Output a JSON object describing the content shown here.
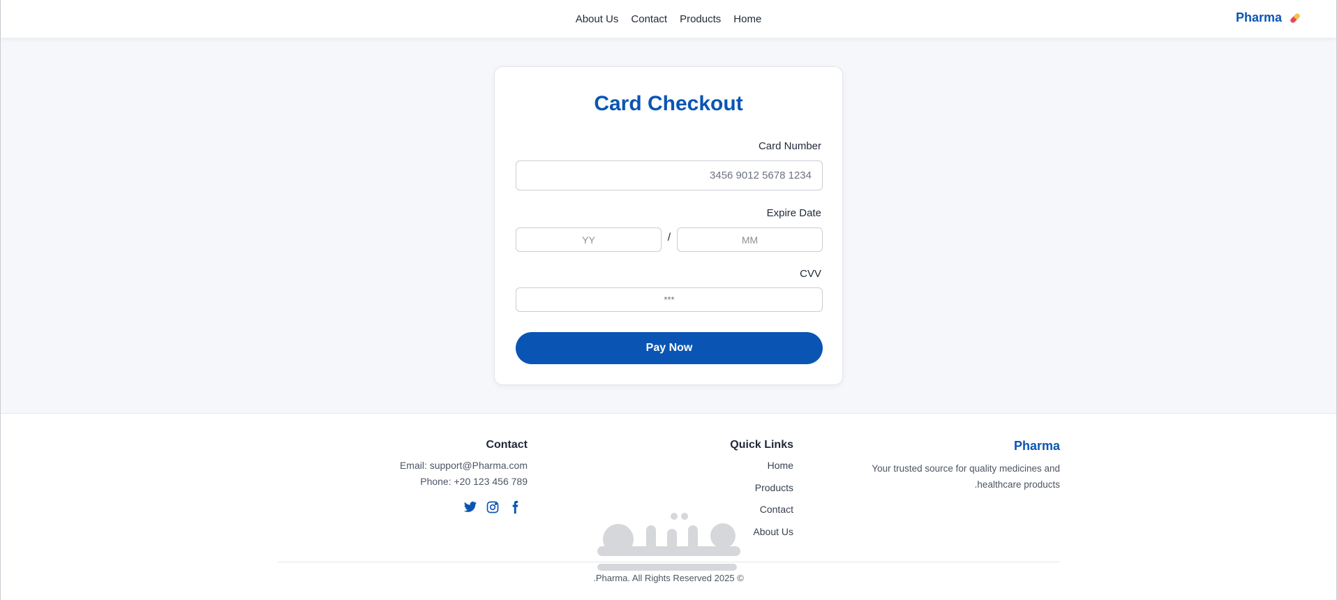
{
  "header": {
    "nav": [
      "About Us",
      "Contact",
      "Products",
      "Home"
    ],
    "brand": "Pharma",
    "brand_icon": "pill-icon"
  },
  "checkout": {
    "title": "Card Checkout",
    "card_number_label": "Card Number",
    "card_number_placeholder": "3456 9012 5678 1234",
    "expire_label": "Expire Date",
    "yy_placeholder": "YY",
    "separator": "/",
    "mm_placeholder": "MM",
    "cvv_label": "CVV",
    "cvv_placeholder": "***",
    "pay_label": "Pay Now"
  },
  "footer": {
    "brand": "Pharma",
    "description": "Your trusted source for quality medicines and healthcare products.",
    "quick_links_heading": "Quick Links",
    "quick_links": [
      "Home",
      "Products",
      "Contact",
      "About Us"
    ],
    "contact_heading": "Contact",
    "email": "Email: support@Pharma.com",
    "phone": "Phone: +20 123 456 789",
    "socials": [
      "twitter-icon",
      "instagram-icon",
      "facebook-icon"
    ],
    "copyright": "© 2025 Pharma. All Rights Reserved."
  },
  "colors": {
    "primary": "#0a55b3",
    "background": "#f5f7fa"
  }
}
